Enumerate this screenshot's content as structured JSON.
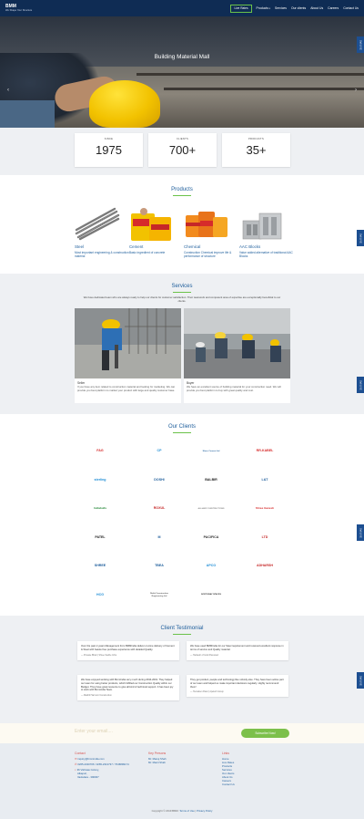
{
  "header": {
    "logo_title": "BMM",
    "logo_tagline": "We Shape Your Structure",
    "nav": [
      "Live Rates",
      "Products",
      "Services",
      "Our clients",
      "About Us",
      "Careers",
      "Contact Us"
    ]
  },
  "hero": {
    "title": "Building Material Mall",
    "prev": "‹",
    "next": "›",
    "active_slide": 2,
    "slide_count": 3
  },
  "side_tab_label": "Sell LIVE",
  "stats": [
    {
      "label": "SINCE",
      "value": "1975"
    },
    {
      "label": "CLIENTS",
      "value": "700+"
    },
    {
      "label": "PRODUCTS",
      "value": "35+"
    }
  ],
  "products": {
    "title": "Products",
    "items": [
      {
        "name": "Steel",
        "desc": "Most important engineering & construction material"
      },
      {
        "name": "Cement",
        "desc": "Basic ingredient of concrete"
      },
      {
        "name": "Chemical",
        "desc": "Construction Chemical improve life & performance of structure"
      },
      {
        "name": "AAC Blocks",
        "desc": "Value added alternative of traditional AAC Blocks"
      }
    ]
  },
  "services": {
    "title": "Services",
    "intro": "We have dedicated team who are always ready to help our clients for customer satisfaction. Their teamwork and competent area of expertise are exceptionally beneficial to our clients.",
    "cards": [
      {
        "title": "Seller",
        "desc": "If you have any item related to construction material and looking for marketing. We can provide you best platform to market your product with large and quality customer base."
      },
      {
        "title": "Buyer",
        "desc": "We have an excellent source of building material for your construction need. We will provide you best platform to buy with great quality and cost."
      }
    ]
  },
  "clients": {
    "title": "Our Clients",
    "logos": [
      "FAG",
      "CP",
      "Shree Cement Ltd",
      "RR-KABEL",
      "sterling",
      "DOSHI",
      "BALBIR",
      "L&T",
      "Indiabulls",
      "ROXUL",
      "ALLIANZ CONSTRUCTIONS",
      "Shree Ganesh",
      "PATEL",
      "M",
      "PACIFICA",
      "LTD",
      "SHREE",
      "TBEA",
      "APCO",
      "ADHARSH",
      "HCG",
      "Rohit Construction Engineering Ltd",
      "NORTHWAY SPACES",
      ""
    ],
    "colors": [
      "#d62b2b",
      "#1f8dd6",
      "#1d5d9b",
      "#d62b2b",
      "#1f8dd6",
      "#1d5d9b",
      "#222",
      "#1d5d9b",
      "#2a8b3d",
      "#c62828",
      "#888",
      "#d62b2b",
      "#222",
      "#1d5d9b",
      "#333",
      "#c62828",
      "#1d5d9b",
      "#1d5d9b",
      "#1f8dd6",
      "#c62828",
      "#1f8dd6",
      "#555",
      "#333",
      "#333"
    ]
  },
  "testimonial": {
    "title": "Client Testimonial",
    "items": [
      {
        "quote": "Over the past 2 years Management from BMMIndia deliver on-time delivery of Cement & Steel with hassle free purchase experience with detailed Quality.",
        "author": "— Pravate Bhatt | Shree Sadhe Infra"
      },
      {
        "quote": "We have used BMMIndia for our Steel requirement and received excellent response in terms of service and Quality material.",
        "author": "— Harkesh of Gold Pavouled"
      },
      {
        "quote": "We have enjoyed working with BmmIndia very much during 2016-2019. They helped our team for using better products, which fulfilled our Construction Quality within our Budget. They have great resource to give all kind of technical support. It has been joy to work with Bmmindia Team.",
        "author": "— Maithli Harmoni Construction"
      },
      {
        "quote": "They get product, people and technology like nobody else. They have been active part of our team and helped us make important decisions regularly. Highly recommend them!",
        "author": "— Hemaben Patel | Apeksh Group"
      }
    ]
  },
  "subscribe": {
    "placeholder": "Enter your email....",
    "button": "Subscribe Now!"
  },
  "footer": {
    "contact_heading": "Contact",
    "email": "inquiry@bmmindia.com",
    "phone": "0265-2320706 / 0265-2313737 / 7046899174",
    "address": [
      "36 Vishwas Colony,",
      "Alkapuri,",
      "Vadodara - 390007"
    ],
    "key_heading": "Key Persons",
    "persons": [
      "Mr. Manoj Shah",
      "Mr. Manit Shah"
    ],
    "links_heading": "Links",
    "links": [
      "Home",
      "Live Rates",
      "Products",
      "Services",
      "Our clients",
      "About Us",
      "Careers",
      "Contact Us"
    ],
    "copyright": "Copyright © 2019 BMM.",
    "terms": "Terms of Use",
    "privacy": "Privacy Policy"
  },
  "colors": {
    "header_bg": "#0f2c54",
    "accent_blue": "#1d5d9b",
    "accent_green": "#7cc04b",
    "footer_heading": "#d9534f"
  },
  "icons": [
    "chevron-left-icon",
    "chevron-right-icon",
    "mail-icon",
    "phone-icon",
    "location-icon"
  ]
}
